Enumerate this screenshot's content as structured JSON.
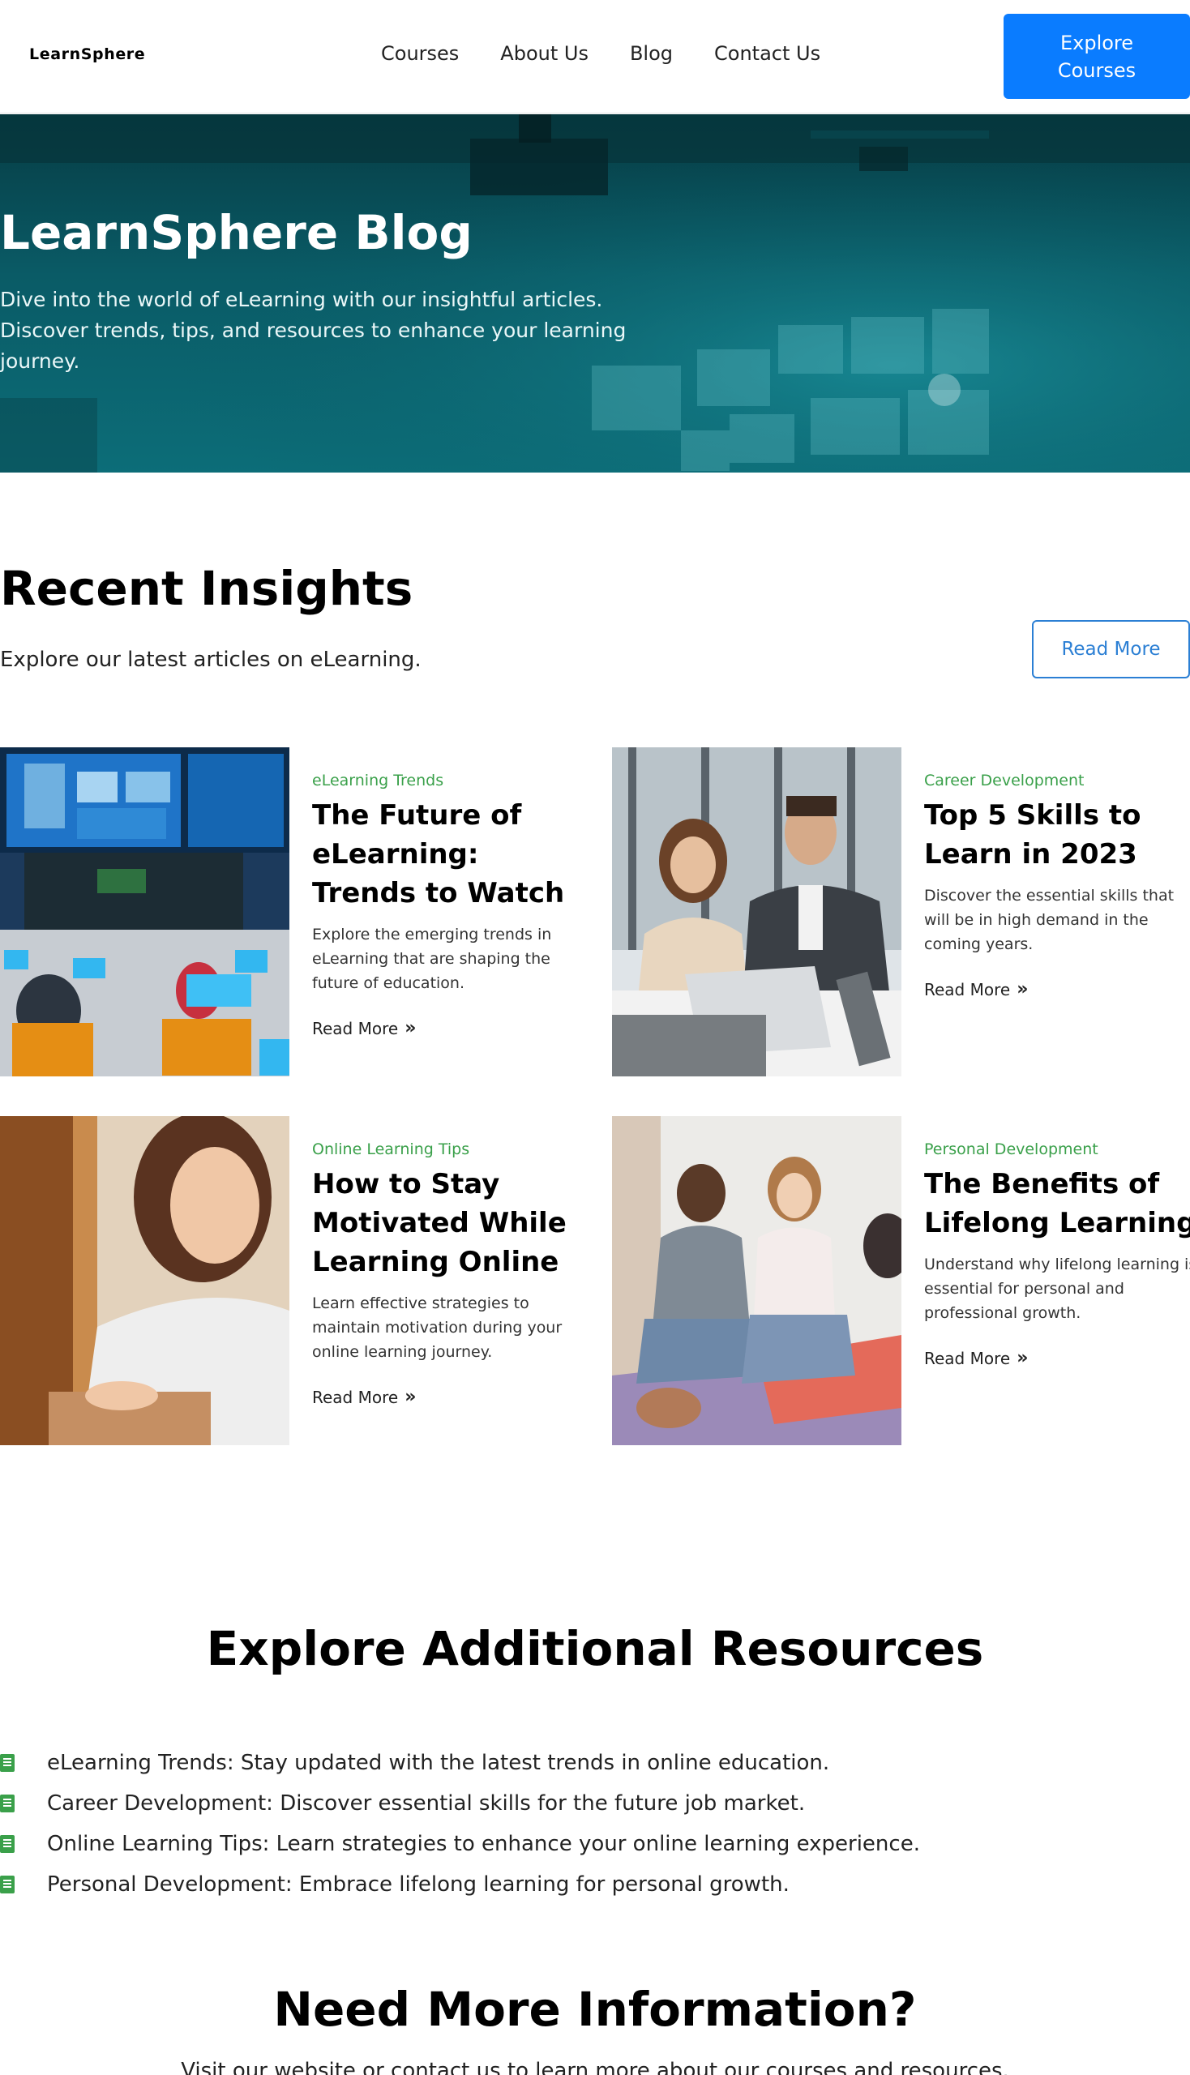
{
  "nav": {
    "logo": "LearnSphere",
    "links": [
      "Courses",
      "About Us",
      "Blog",
      "Contact Us"
    ],
    "cta": "Explore Courses",
    "accent": "#0a7cff"
  },
  "hero": {
    "title": "LearnSphere Blog",
    "subtitle": "Dive into the world of eLearning with our insightful articles. Discover trends, tips, and resources to enhance your learning journey."
  },
  "insights": {
    "title": "Recent Insights",
    "subtitle": "Explore our latest articles on eLearning.",
    "button": "Read More",
    "category_color": "#3aa04a",
    "articles": [
      {
        "category": "eLearning Trends",
        "title": "The Future of eLearning: Trends to Watch",
        "description": "Explore the emerging trends in eLearning that are shaping the future of education.",
        "link": "Read More",
        "image": "classroom-computers-photo"
      },
      {
        "category": "Career Development",
        "title": "Top 5 Skills to Learn in 2023",
        "description": "Discover the essential skills that will be in high demand in the coming years.",
        "link": "Read More",
        "image": "office-colleagues-laptop-photo"
      },
      {
        "category": "Online Learning Tips",
        "title": "How to Stay Motivated While Learning Online",
        "description": "Learn effective strategies to maintain motivation during your online learning journey.",
        "link": "Read More",
        "image": "smiling-woman-laptop-photo"
      },
      {
        "category": "Personal Development",
        "title": "The Benefits of Lifelong Learning",
        "description": "Understand why lifelong learning is essential for personal and professional growth.",
        "link": "Read More",
        "image": "group-sitting-floor-photo"
      }
    ]
  },
  "resources": {
    "title": "Explore Additional Resources",
    "icon": "book-icon",
    "items": [
      "eLearning Trends: Stay updated with the latest trends in online education.",
      "Career Development: Discover essential skills for the future job market.",
      "Online Learning Tips: Learn strategies to enhance your online learning experience.",
      "Personal Development: Embrace lifelong learning for personal growth."
    ]
  },
  "info": {
    "title": "Need More Information?",
    "subtitle": "Visit our website or contact us to learn more about our courses and resources."
  }
}
